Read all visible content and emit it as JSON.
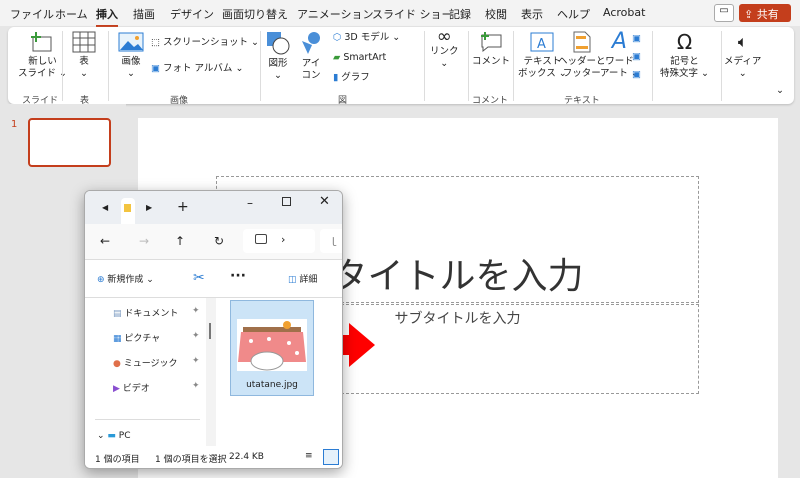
{
  "menu_tabs": [
    "ファイル",
    "ホーム",
    "挿入",
    "描画",
    "デザイン",
    "画面切り替え",
    "アニメーション",
    "スライド ショー",
    "記録",
    "校閲",
    "表示",
    "ヘルプ",
    "Acrobat"
  ],
  "active_tab": "挿入",
  "share_label": "共有",
  "ribbon": {
    "new_slide": "新しい",
    "new_slide2": "スライド ⌄",
    "table": "表",
    "images": "画像",
    "screenshot": "スクリーンショット ⌄",
    "photo_album": "フォト アルバム  ⌄",
    "shapes": "図形",
    "icons1": "アイ",
    "icons2": "コン",
    "model3d": "3D モデル",
    "smartart": "SmartArt",
    "graph": "グラフ",
    "link": "リンク",
    "comment": "コメント",
    "textbox1": "テキスト",
    "textbox2": "ボックス ⌄",
    "hf1": "ヘッダーと",
    "hf2": "フッター",
    "wordart1": "ワード",
    "wordart2": "アート ⌄",
    "symbol1": "記号と",
    "symbol2": "特殊文字 ⌄",
    "media": "メディア",
    "groups": {
      "slide": "スライド",
      "table": "表",
      "images": "画像",
      "illustrations": "図",
      "comment": "コメント",
      "text": "テキスト"
    }
  },
  "thumbnail_number": "1",
  "slide": {
    "title": "タイトルを入力",
    "subtitle": "サブタイトルを入力"
  },
  "explorer": {
    "new_label": "新規作成",
    "details_label": "詳細",
    "nav": [
      "ドキュメント",
      "ピクチャ",
      "ミュージック",
      "ビデオ"
    ],
    "pc": "PC",
    "file_name": "utatane.jpg",
    "status_count": "1 個の項目",
    "status_selected": "1 個の項目を選択",
    "status_size": "22.4 KB"
  },
  "colors": {
    "accent": "#c43e1c",
    "arrow": "#ff0000"
  }
}
